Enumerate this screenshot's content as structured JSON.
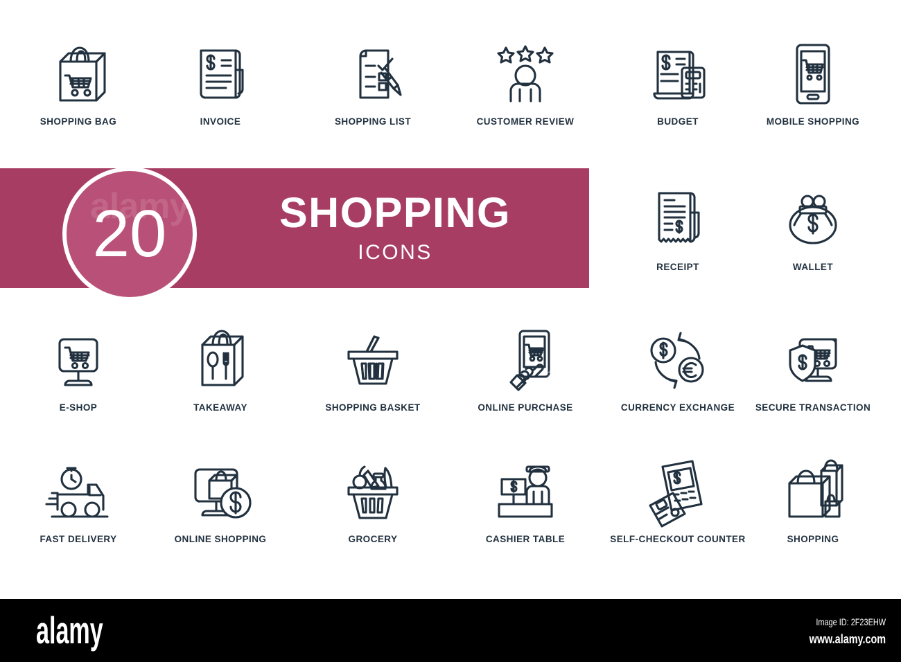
{
  "banner": {
    "count": "20",
    "title": "SHOPPING",
    "subtitle": "ICONS",
    "bg_color": "#a83d63",
    "badge_color": "#b95077",
    "watermark_a": "a",
    "watermark_badge": "alamy",
    "watermark_bottom": "alamy"
  },
  "icons": {
    "stroke_color": "#22313f",
    "items": [
      {
        "label": "SHOPPING BAG",
        "icon": "shopping-bag-icon",
        "row": 0,
        "col": 0
      },
      {
        "label": "INVOICE",
        "icon": "invoice-icon",
        "row": 0,
        "col": 1
      },
      {
        "label": "SHOPPING LIST",
        "icon": "shopping-list-icon",
        "row": 0,
        "col": 2
      },
      {
        "label": "CUSTOMER REVIEW",
        "icon": "customer-review-icon",
        "row": 0,
        "col": 3
      },
      {
        "label": "BUDGET",
        "icon": "budget-icon",
        "row": 0,
        "col": 4
      },
      {
        "label": "MOBILE SHOPPING",
        "icon": "mobile-shopping-icon",
        "row": 0,
        "col": 5
      },
      {
        "label": "RECEIPT",
        "icon": "receipt-icon",
        "row": 1,
        "col": 4
      },
      {
        "label": "WALLET",
        "icon": "wallet-icon",
        "row": 1,
        "col": 5
      },
      {
        "label": "E-SHOP",
        "icon": "e-shop-icon",
        "row": 2,
        "col": 0
      },
      {
        "label": "TAKEAWAY",
        "icon": "takeaway-icon",
        "row": 2,
        "col": 1
      },
      {
        "label": "SHOPPING BASKET",
        "icon": "shopping-basket-icon",
        "row": 2,
        "col": 2
      },
      {
        "label": "ONLINE PURCHASE",
        "icon": "online-purchase-icon",
        "row": 2,
        "col": 3
      },
      {
        "label": "CURRENCY EXCHANGE",
        "icon": "currency-exchange-icon",
        "row": 2,
        "col": 4
      },
      {
        "label": "SECURE TRANSACTION",
        "icon": "secure-transaction-icon",
        "row": 2,
        "col": 5
      },
      {
        "label": "FAST DELIVERY",
        "icon": "fast-delivery-icon",
        "row": 3,
        "col": 0
      },
      {
        "label": "ONLINE SHOPPING",
        "icon": "online-shopping-icon",
        "row": 3,
        "col": 1
      },
      {
        "label": "GROCERY",
        "icon": "grocery-icon",
        "row": 3,
        "col": 2
      },
      {
        "label": "CASHIER TABLE",
        "icon": "cashier-table-icon",
        "row": 3,
        "col": 3
      },
      {
        "label": "SELF-CHECKOUT COUNTER",
        "icon": "self-checkout-counter-icon",
        "row": 3,
        "col": 4
      },
      {
        "label": "SHOPPING",
        "icon": "shopping-icon",
        "row": 3,
        "col": 5
      }
    ]
  },
  "footer": {
    "logo": "alamy",
    "image_id": "Image ID: 2F23EHW",
    "url": "www.alamy.com",
    "bg_color": "#000000"
  }
}
